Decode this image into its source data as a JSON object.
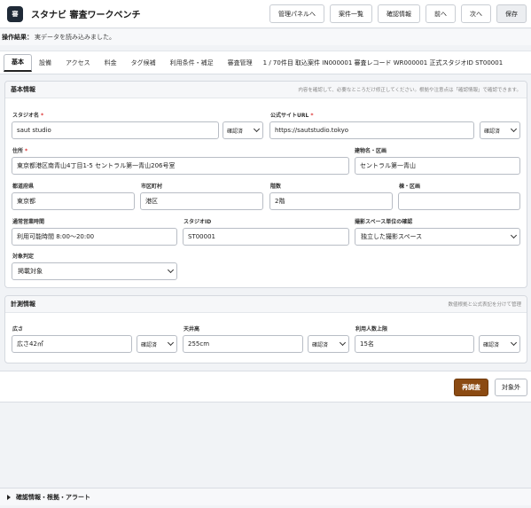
{
  "header": {
    "logo_text": "審",
    "title": "スタナビ 審査ワークベンチ",
    "buttons": [
      "管理パネルへ",
      "案件一覧",
      "確認情報",
      "前へ",
      "次へ",
      "保存"
    ]
  },
  "status": {
    "label": "操作結果：",
    "message": "実データを読み込みました。"
  },
  "tabs": [
    "基本",
    "設備",
    "アクセス",
    "料金",
    "タグ候補",
    "利用条件・補足",
    "審査管理"
  ],
  "active_tab": "基本",
  "record_info": "1 / 70件目 取込案件 IN000001 審査レコード WR000001 正式スタジオID ST00001",
  "basic": {
    "title": "基本情報",
    "hint": "内容を確認して、必要なところだけ修正してください。根拠や注意点は「確認情報」で確認できます。",
    "studio_name": {
      "label": "スタジオ名",
      "value": "saut studio",
      "status": "確認済"
    },
    "website": {
      "label": "公式サイトURL",
      "value": "https://sautstudio.tokyo",
      "status": "確認済"
    },
    "address": {
      "label": "住所",
      "value": "東京都港区南青山4丁目1-5 セントラル第一青山206号室"
    },
    "building": {
      "label": "建物名・区画",
      "value": "セントラル第一青山"
    },
    "prefecture": {
      "label": "都道府県",
      "value": "東京都"
    },
    "city": {
      "label": "市区町村",
      "value": "港区"
    },
    "floor": {
      "label": "階数",
      "value": "2階"
    },
    "block": {
      "label": "棟・区画",
      "value": ""
    },
    "hours": {
      "label": "通常営業時間",
      "value": "利用可能時間 8:00〜20:00"
    },
    "studio_id": {
      "label": "スタジオID",
      "value": "ST00001"
    },
    "space_unit": {
      "label": "撮影スペース単位の確認",
      "value": "独立した撮影スペース"
    },
    "target": {
      "label": "対象判定",
      "value": "掲載対象"
    },
    "required_mark": "*"
  },
  "measure": {
    "title": "計測情報",
    "hint": "数値根拠と公式表記を分けて管理",
    "area": {
      "label": "広さ",
      "value": "広さ42㎡",
      "status": "確認済"
    },
    "ceiling": {
      "label": "天井高",
      "value": "255cm",
      "status": "確認済"
    },
    "capacity": {
      "label": "利用人数上限",
      "value": "15名",
      "status": "確認済"
    }
  },
  "actions": {
    "recheck": "再調査",
    "exclude": "対象外"
  },
  "accordion": {
    "label": "確認情報・根拠・アラート"
  }
}
